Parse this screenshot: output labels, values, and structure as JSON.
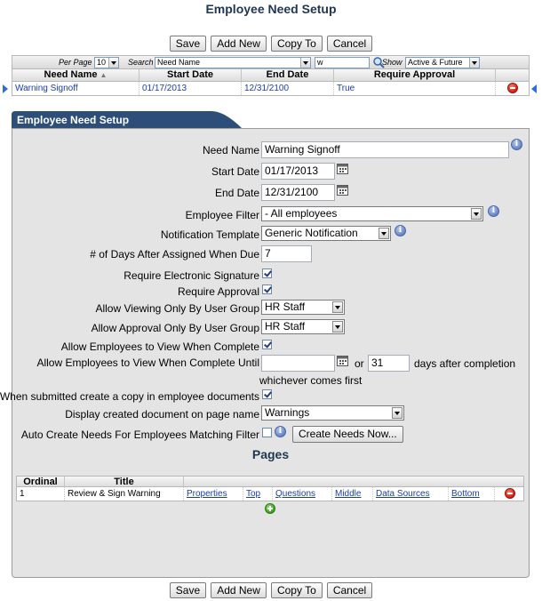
{
  "page_title": "Employee Need Setup",
  "toolbar": {
    "save": "Save",
    "add_new": "Add New",
    "copy_to": "Copy To",
    "cancel": "Cancel"
  },
  "filter": {
    "per_page_label": "Per Page",
    "per_page_value": "10",
    "search_label": "Search",
    "search_field": "Need Name",
    "search_value": "w",
    "show_label": "Show",
    "show_value": "Active & Future"
  },
  "grid": {
    "columns": [
      "Need Name",
      "Start Date",
      "End Date",
      "Require Approval"
    ],
    "rows": [
      {
        "need_name": "Warning Signoff",
        "start_date": "01/17/2013",
        "end_date": "12/31/2100",
        "require_approval": "True"
      }
    ]
  },
  "panel_title": "Employee Need Setup",
  "form": {
    "need_name_label": "Need Name",
    "need_name_value": "Warning Signoff",
    "start_date_label": "Start Date",
    "start_date_value": "01/17/2013",
    "end_date_label": "End Date",
    "end_date_value": "12/31/2100",
    "employee_filter_label": "Employee Filter",
    "employee_filter_value": "- All employees",
    "notification_template_label": "Notification Template",
    "notification_template_value": "Generic Notification",
    "days_after_label": "# of Days After Assigned When Due",
    "days_after_value": "7",
    "require_esig_label": "Require Electronic Signature",
    "require_approval_label": "Require Approval",
    "allow_viewing_label": "Allow Viewing Only By User Group",
    "allow_viewing_value": "HR Staff",
    "allow_approval_label": "Allow Approval Only By User Group",
    "allow_approval_value": "HR Staff",
    "allow_view_complete_label": "Allow Employees to View When Complete",
    "allow_view_until_label": "Allow Employees to View When Complete Until",
    "allow_view_until_date": "",
    "or_text": "or",
    "days_value": "31",
    "days_after_completion": "days after completion",
    "whichever_first": "whichever comes first",
    "submitted_copy_label": "When submitted create a copy in employee documents",
    "display_doc_label": "Display created document on page name",
    "display_doc_value": "Warnings",
    "auto_create_label": "Auto Create Needs For Employees Matching Filter",
    "create_needs_button": "Create Needs Now..."
  },
  "checkboxes": {
    "require_esig": true,
    "require_approval": true,
    "allow_view_complete": true,
    "submitted_copy": true,
    "auto_create": false
  },
  "pages": {
    "title": "Pages",
    "columns": [
      "Ordinal",
      "Title"
    ],
    "rows": [
      {
        "ordinal": "1",
        "title": "Review & Sign Warning",
        "properties": "Properties",
        "top": "Top",
        "questions": "Questions",
        "middle": "Middle",
        "data_sources": "Data Sources",
        "bottom": "Bottom"
      }
    ]
  },
  "colors": {
    "title": "#1f3650",
    "panel_header": "#2e4e7a",
    "link": "#1a3ea8",
    "row_pointer": "#2b6fd6"
  }
}
